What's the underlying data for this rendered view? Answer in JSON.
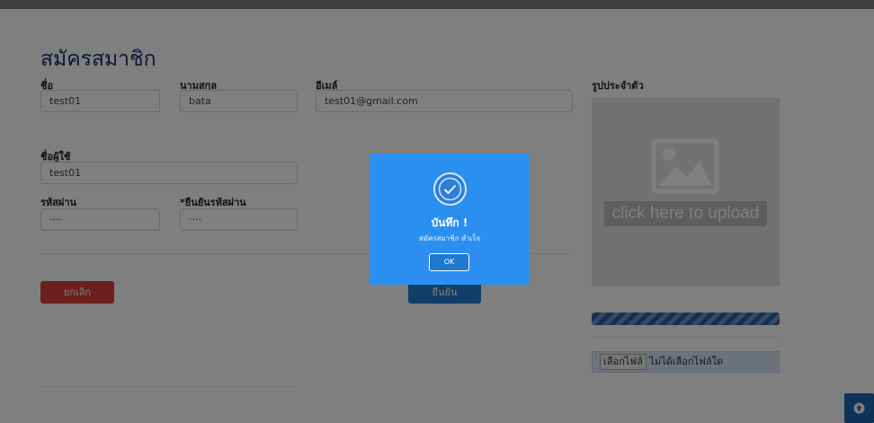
{
  "page": {
    "title": "สมัครสมาชิก"
  },
  "form": {
    "first_name": {
      "label": "ชื่อ",
      "value": "test01"
    },
    "last_name": {
      "label": "นามสกุล",
      "value": "bata"
    },
    "email": {
      "label": "อีเมล์",
      "value": "test01@gmail.com"
    },
    "username": {
      "label": "ชื่อผู้ใช้",
      "value": "test01"
    },
    "password": {
      "label": "รหัสผ่าน",
      "value": "····"
    },
    "password_confirm": {
      "label": "*ยืนยันรหัสผ่าน",
      "value": "····"
    },
    "cancel_label": "ยกเลิก",
    "confirm_label": "ยืนยัน"
  },
  "profile": {
    "label": "รูปประจำตัว",
    "upload_text": "click here to upload",
    "progress_percent": 100,
    "file_button": "เลือกไฟล์",
    "file_status": "ไม่ได้เลือกไฟล์ใด"
  },
  "modal": {
    "title": "บันทึก !",
    "message": "สมัครสมาชิก สำเร็จ",
    "ok_label": "OK"
  },
  "colors": {
    "modal_bg": "#2b8ff0",
    "primary": "#1e7fcf",
    "danger": "#d9413a",
    "title": "#1a2f6b"
  },
  "icons": {
    "modal": "check-circle-icon",
    "upload": "image-icon",
    "scroll_top": "arrow-up-circle-icon"
  }
}
